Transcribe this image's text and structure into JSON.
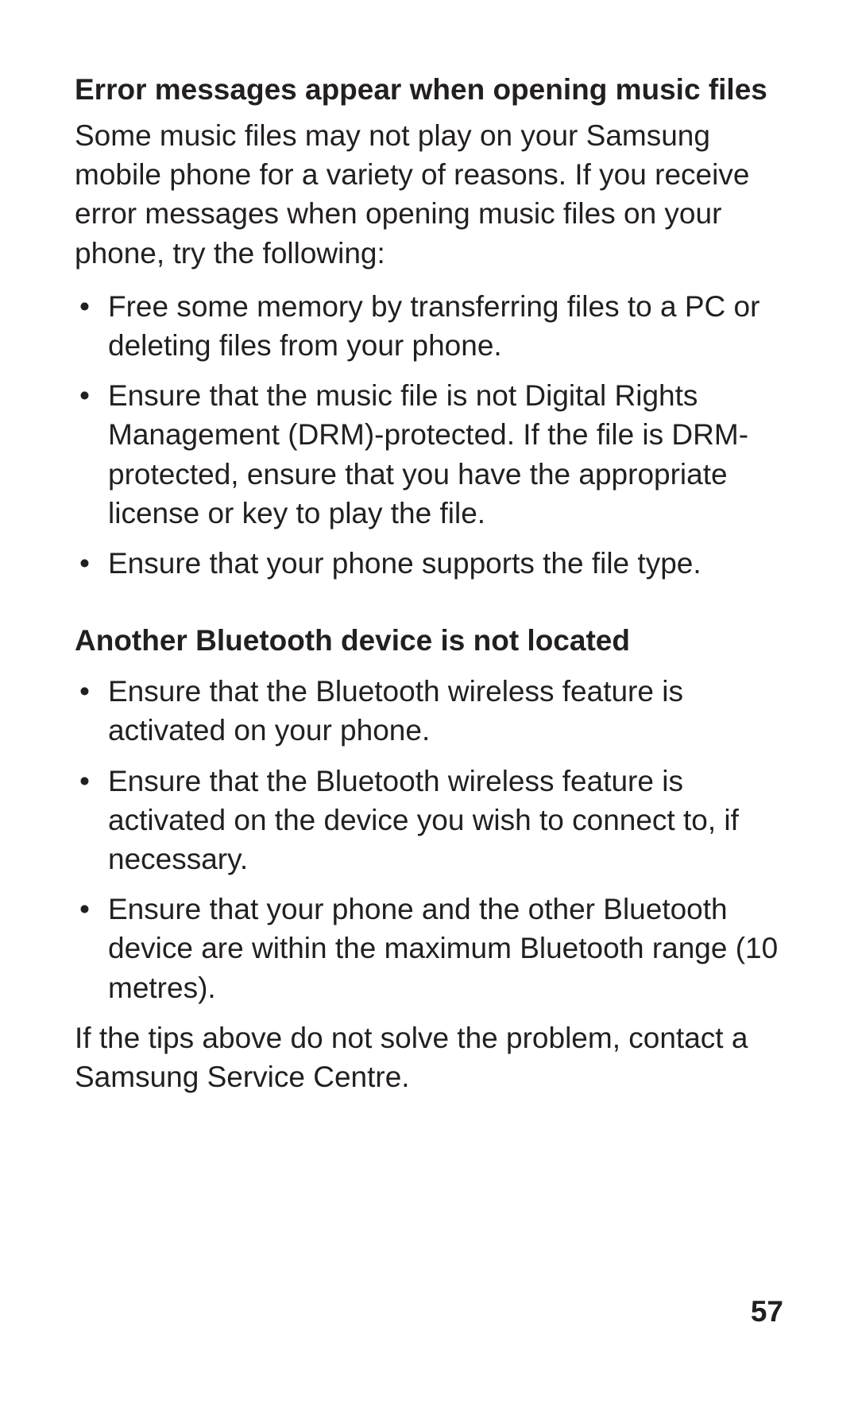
{
  "section1": {
    "heading": "Error messages appear when opening music files",
    "intro": "Some music files may not play on your Samsung mobile phone for a variety of reasons. If you receive error messages when opening music files on your phone, try the following:",
    "bullets": [
      "Free some memory by transferring files to a PC or deleting files from your phone.",
      "Ensure that the music file is not Digital Rights Management (DRM)-protected. If the file is DRM-protected, ensure that you have the appropriate license or key to play the file.",
      "Ensure that your phone supports the file type."
    ]
  },
  "section2": {
    "heading": "Another Bluetooth device is not located",
    "bullets": [
      "Ensure that the Bluetooth wireless feature is activated on your phone.",
      "Ensure that the Bluetooth wireless feature is activated on the device you wish to connect to, if necessary.",
      "Ensure that your phone and the other Bluetooth device are within the maximum Bluetooth range (10 metres)."
    ],
    "closing": "If the tips above do not solve the problem, contact a Samsung Service Centre."
  },
  "page_number": "57"
}
